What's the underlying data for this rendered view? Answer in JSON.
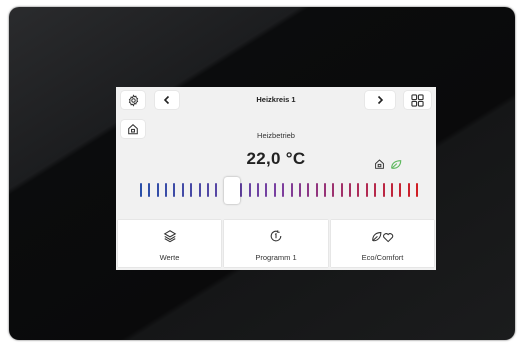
{
  "header": {
    "title": "Heizkreis 1",
    "settings_icon": "gear-icon",
    "prev_icon": "chevron-left-icon",
    "next_icon": "chevron-right-icon",
    "menu_icon": "grid-icon"
  },
  "main": {
    "mode_label": "Heizbetrieb",
    "temperature": "22,0 °C",
    "status_icons": [
      "house-icon",
      "leaf-icon"
    ],
    "slider_level": 0.33,
    "colors": {
      "cold": "#2a4fa8",
      "mid": "#7a3ea0",
      "hot": "#d01e24",
      "leaf": "#5cb85c"
    }
  },
  "footer": {
    "buttons": [
      {
        "label": "Werte",
        "icon": "layers-icon"
      },
      {
        "label": "Programm 1",
        "icon": "program-clock-icon"
      },
      {
        "label": "Eco/Comfort",
        "icon": "leaf-heart-icon"
      }
    ]
  }
}
